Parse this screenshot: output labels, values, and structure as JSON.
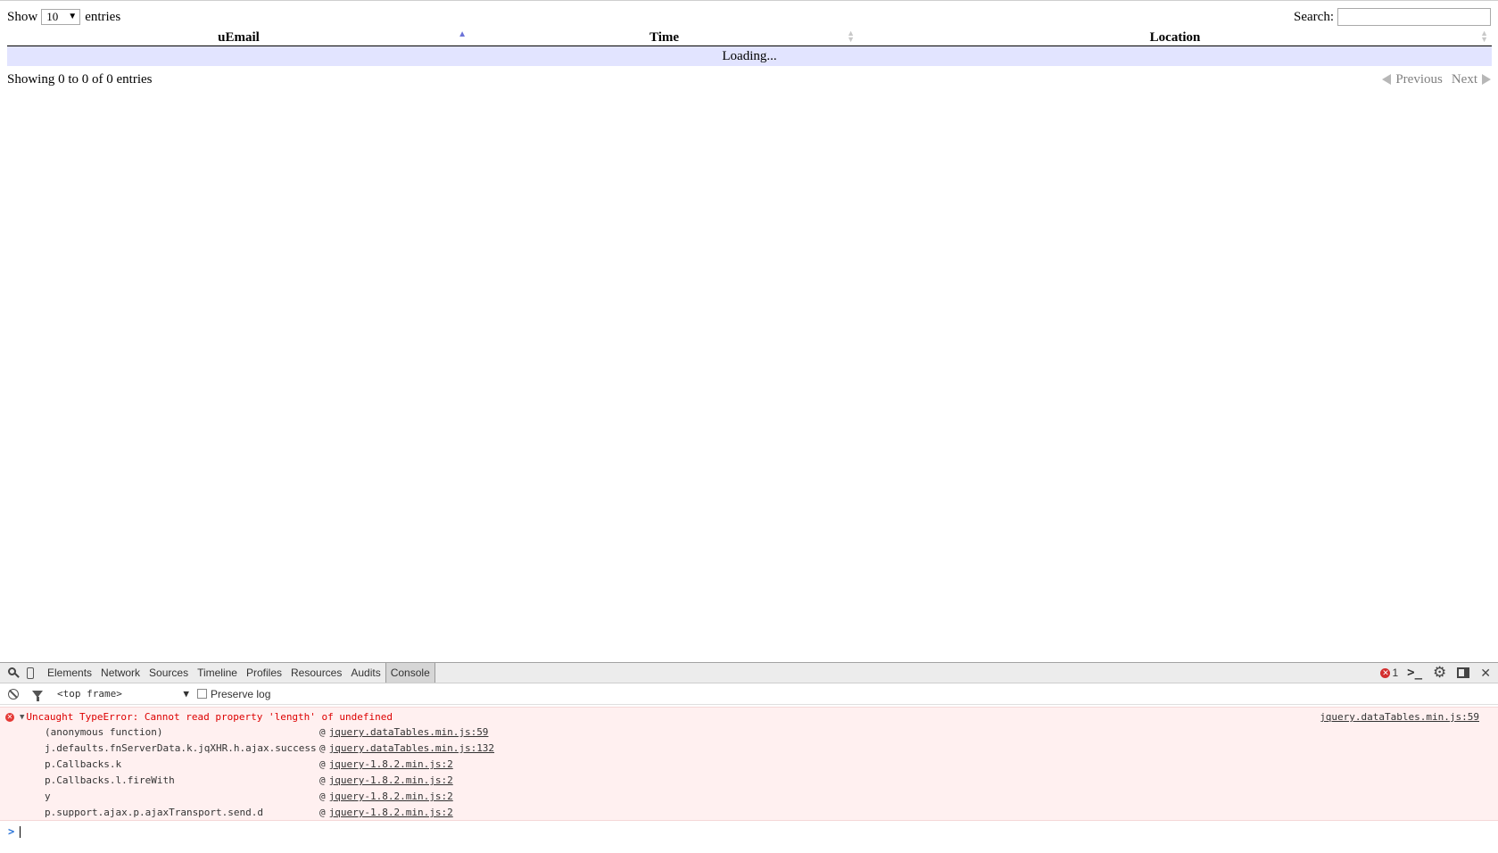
{
  "datatable": {
    "length": {
      "show_label": "Show",
      "value": "10",
      "entries_label": "entries"
    },
    "search": {
      "label": "Search:",
      "value": ""
    },
    "columns": [
      "uEmail",
      "Time",
      "Location"
    ],
    "loading_text": "Loading...",
    "info": "Showing 0 to 0 of 0 entries",
    "pagination": {
      "previous": "Previous",
      "next": "Next"
    }
  },
  "devtools": {
    "tabs": [
      "Elements",
      "Network",
      "Sources",
      "Timeline",
      "Profiles",
      "Resources",
      "Audits",
      "Console"
    ],
    "active_tab": "Console",
    "error_count": "1",
    "frame_selector": "<top frame>",
    "preserve_log_label": "Preserve log",
    "error": {
      "message": "Uncaught TypeError: Cannot read property 'length' of undefined",
      "source": "jquery.dataTables.min.js:59",
      "stack": [
        {
          "fn": "(anonymous function)",
          "loc": "jquery.dataTables.min.js:59"
        },
        {
          "fn": "j.defaults.fnServerData.k.jqXHR.h.ajax.success",
          "loc": "jquery.dataTables.min.js:132"
        },
        {
          "fn": "p.Callbacks.k",
          "loc": "jquery-1.8.2.min.js:2"
        },
        {
          "fn": "p.Callbacks.l.fireWith",
          "loc": "jquery-1.8.2.min.js:2"
        },
        {
          "fn": "y",
          "loc": "jquery-1.8.2.min.js:2"
        },
        {
          "fn": "p.support.ajax.p.ajaxTransport.send.d",
          "loc": "jquery-1.8.2.min.js:2"
        }
      ]
    },
    "prompt_symbol": ">",
    "icons": [
      "search-icon",
      "device-mode-icon",
      "error-icon",
      "drawer-icon",
      "gear-icon",
      "dock-icon",
      "close-icon",
      "clear-console-icon",
      "filter-icon"
    ],
    "colors": {
      "error_text": "#dd0000",
      "error_bg": "#fff0f0",
      "selected_row": "#e2e4ff",
      "sort_active": "#6b72d8"
    }
  }
}
